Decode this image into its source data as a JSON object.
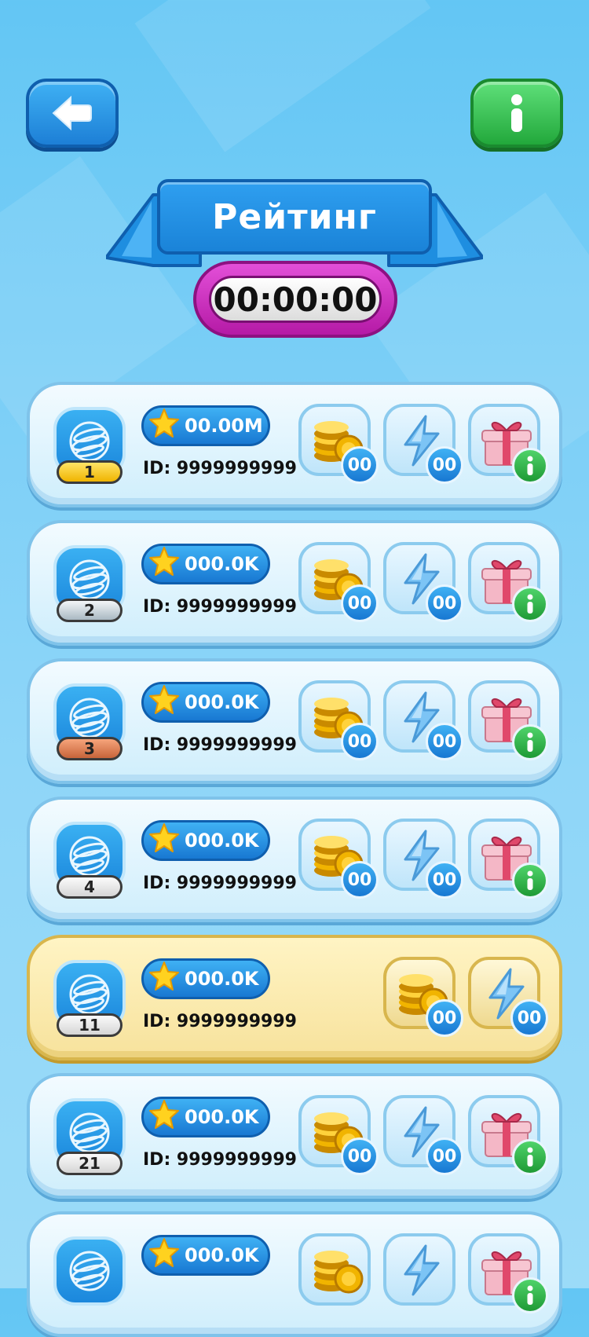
{
  "header": {
    "title": "Рейтинг",
    "timer": "00:00:00"
  },
  "icons": {
    "back": "back-arrow-icon",
    "info": "info-icon",
    "avatar": "globe-icon",
    "score": "star-icon",
    "coins": "coins-icon",
    "energy": "lightning-icon",
    "gift": "gift-icon"
  },
  "colors": {
    "accent": "#1a83d8",
    "timer": "#b51aa6",
    "info": "#22a83b",
    "highlight": "#f7e29c"
  },
  "rows": [
    {
      "rank": "1",
      "score": "00.00M",
      "id": "ID: 9999999999",
      "coins": "00",
      "energy": "00",
      "gift": true
    },
    {
      "rank": "2",
      "score": "000.0K",
      "id": "ID: 9999999999",
      "coins": "00",
      "energy": "00",
      "gift": true
    },
    {
      "rank": "3",
      "score": "000.0K",
      "id": "ID: 9999999999",
      "coins": "00",
      "energy": "00",
      "gift": true
    },
    {
      "rank": "4",
      "score": "000.0K",
      "id": "ID: 9999999999",
      "coins": "00",
      "energy": "00",
      "gift": true
    },
    {
      "rank": "11",
      "score": "000.0K",
      "id": "ID: 9999999999",
      "coins": "00",
      "energy": "00",
      "gift": false
    },
    {
      "rank": "21",
      "score": "000.0K",
      "id": "ID: 9999999999",
      "coins": "00",
      "energy": "00",
      "gift": true
    },
    {
      "rank": "",
      "score": "000.0K",
      "id": "",
      "coins": "",
      "energy": "",
      "gift": true
    }
  ]
}
